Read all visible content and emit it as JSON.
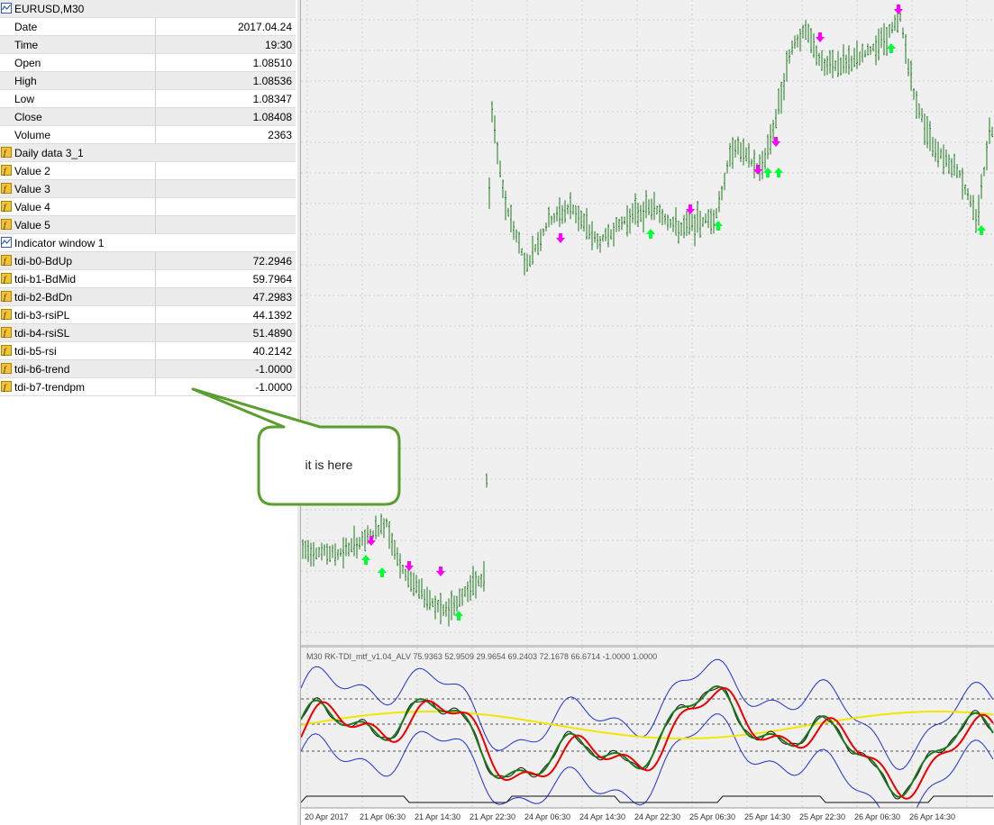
{
  "data_window": {
    "symbol": "EURUSD,M30",
    "price_fields": [
      {
        "label": "Date",
        "value": "2017.04.24"
      },
      {
        "label": "Time",
        "value": "19:30"
      },
      {
        "label": "Open",
        "value": "1.08510"
      },
      {
        "label": "High",
        "value": "1.08536"
      },
      {
        "label": "Low",
        "value": "1.08347"
      },
      {
        "label": "Close",
        "value": "1.08408"
      },
      {
        "label": "Volume",
        "value": "2363"
      }
    ],
    "indicator_1": {
      "name": "Daily data 3_1",
      "values": [
        {
          "label": "Value 2",
          "value": ""
        },
        {
          "label": "Value 3",
          "value": ""
        },
        {
          "label": "Value 4",
          "value": ""
        },
        {
          "label": "Value 5",
          "value": ""
        }
      ]
    },
    "indicator_window": {
      "name": "Indicator window 1",
      "values": [
        {
          "label": "tdi-b0-BdUp",
          "value": "72.2946"
        },
        {
          "label": "tdi-b1-BdMid",
          "value": "59.7964"
        },
        {
          "label": "tdi-b2-BdDn",
          "value": "47.2983"
        },
        {
          "label": "tdi-b3-rsiPL",
          "value": "44.1392"
        },
        {
          "label": "tdi-b4-rsiSL",
          "value": "51.4890"
        },
        {
          "label": "tdi-b5-rsi",
          "value": "40.2142"
        },
        {
          "label": "tdi-b6-trend",
          "value": "-1.0000"
        },
        {
          "label": "tdi-b7-trendpm",
          "value": "-1.0000"
        }
      ]
    }
  },
  "callout": {
    "text": "it is here"
  },
  "subwindow": {
    "title": "M30 RK-TDI_mtf_v1.04_ALV 75.9363 52.9509 29.9654 69.2403 72.1678 66.6714 -1.0000 1.0000"
  },
  "x_axis_labels": [
    "20 Apr 2017",
    "21 Apr 06:30",
    "21 Apr 14:30",
    "21 Apr 22:30",
    "24 Apr 06:30",
    "24 Apr 14:30",
    "24 Apr 22:30",
    "25 Apr 06:30",
    "25 Apr 14:30",
    "25 Apr 22:30",
    "26 Apr 06:30",
    "26 Apr 14:30"
  ],
  "colors": {
    "bar": "#1f7a1f",
    "up_arrow": "#00ff33",
    "down_arrow": "#ff00ff",
    "grid": "#d0d0d0",
    "chart_bg": "#f0f0f0",
    "band": "#1f2fd0",
    "rsi_fast": "#1a7a1a",
    "rsi_slow": "#ee0000",
    "mid_band": "#f2e600",
    "callout_border": "#5a9e2f"
  },
  "icons": {
    "chart": "chart-line-icon",
    "indicator": "function-icon",
    "indicator_window": "indicator-window-icon"
  }
}
